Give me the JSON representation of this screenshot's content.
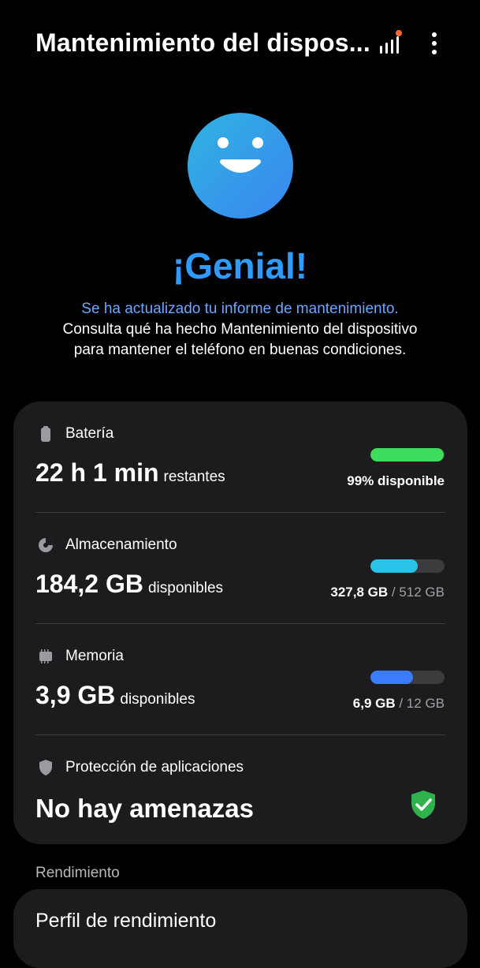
{
  "header": {
    "title": "Mantenimiento del dispos...",
    "notification_dot_color": "#ff6a2a"
  },
  "hero": {
    "icon": "smiley-face-icon",
    "title": "¡Genial!",
    "link_text": "Se ha actualizado tu informe de mantenimiento.",
    "description": "Consulta qué ha hecho Mantenimiento del dispositivo para mantener el teléfono en buenas condiciones."
  },
  "battery": {
    "label": "Batería",
    "value": "22 h 1 min",
    "unit": "restantes",
    "status": "99% disponible",
    "level": 0.99,
    "color": "#3ddc5c"
  },
  "storage": {
    "label": "Almacenamiento",
    "value": "184,2 GB",
    "unit": "disponibles",
    "used": "327,8 GB",
    "total": "/ 512 GB",
    "level": 0.64,
    "color": "#2bc4e8"
  },
  "memory": {
    "label": "Memoria",
    "value": "3,9 GB",
    "unit": "disponibles",
    "used": "6,9 GB",
    "total": "/ 12 GB",
    "level": 0.575,
    "color": "#3a7bff"
  },
  "app_protection": {
    "label": "Protección de aplicaciones",
    "value": "No hay amenazas",
    "shield_color": "#2fb24c"
  },
  "performance": {
    "section_header": "Rendimiento",
    "profile_label": "Perfil de rendimiento"
  }
}
